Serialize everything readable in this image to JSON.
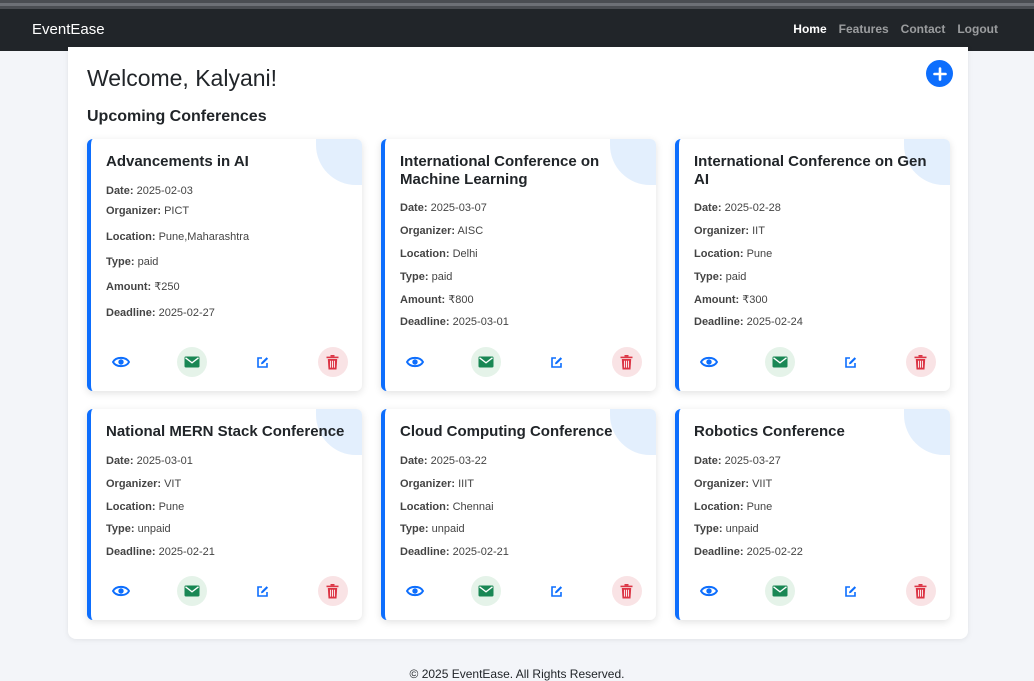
{
  "navbar": {
    "brand": "EventEase",
    "links": [
      {
        "label": "Home"
      },
      {
        "label": "Features"
      },
      {
        "label": "Contact"
      },
      {
        "label": "Logout"
      }
    ]
  },
  "main": {
    "welcome": "Welcome, Kalyani!",
    "section_title": "Upcoming Conferences",
    "field_labels": {
      "date": "Date:",
      "organizer": "Organizer:",
      "location": "Location:",
      "type": "Type:",
      "amount": "Amount:",
      "deadline": "Deadline:"
    },
    "conferences": [
      {
        "title": "Advancements in AI",
        "date": "2025-02-03",
        "organizer": "PICT",
        "location": "Pune,Maharashtra",
        "type": "paid",
        "amount": "₹250",
        "deadline": "2025-02-27"
      },
      {
        "title": "International Conference on Machine Learning",
        "date": "2025-03-07",
        "organizer": "AISC",
        "location": "Delhi",
        "type": "paid",
        "amount": "₹800",
        "deadline": "2025-03-01"
      },
      {
        "title": "International Conference on Gen AI",
        "date": "2025-02-28",
        "organizer": "IIT",
        "location": "Pune",
        "type": "paid",
        "amount": "₹300",
        "deadline": "2025-02-24"
      },
      {
        "title": "National MERN Stack Conference",
        "date": "2025-03-01",
        "organizer": "VIT",
        "location": "Pune",
        "type": "unpaid",
        "deadline": "2025-02-21"
      },
      {
        "title": "Cloud Computing Conference",
        "date": "2025-03-22",
        "organizer": "IIIT",
        "location": "Chennai",
        "type": "unpaid",
        "deadline": "2025-02-21"
      },
      {
        "title": "Robotics Conference",
        "date": "2025-03-27",
        "organizer": "VIIT",
        "location": "Pune",
        "type": "unpaid",
        "deadline": "2025-02-22"
      }
    ]
  },
  "icons": {
    "add": "plus-icon",
    "view": "eye-icon",
    "email": "envelope-icon",
    "edit": "edit-icon",
    "delete": "trash-icon"
  },
  "colors": {
    "primary": "#0d6efd",
    "success": "#198754",
    "danger": "#dc3545",
    "navbar": "#212529"
  },
  "footer": {
    "text": "© 2025 EventEase. All Rights Reserved."
  }
}
